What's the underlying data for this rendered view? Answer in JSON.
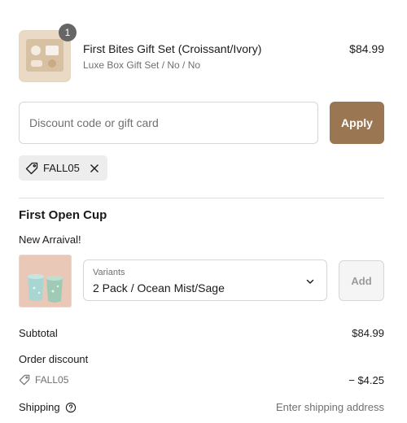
{
  "line_item": {
    "quantity": "1",
    "title": "First Bites Gift Set (Croissant/Ivory)",
    "variant": "Luxe Box Gift Set / No / No",
    "price": "$84.99"
  },
  "discount": {
    "placeholder": "Discount code or gift card",
    "value": "",
    "apply_label": "Apply",
    "applied_code": "FALL05"
  },
  "upsell": {
    "title": "First Open Cup",
    "subtitle": "New Arraival!",
    "variant_label": "Variants",
    "variant_value": "2 Pack / Ocean Mist/Sage",
    "add_label": "Add"
  },
  "summary": {
    "subtotal_label": "Subtotal",
    "subtotal_value": "$84.99",
    "order_discount_label": "Order discount",
    "discount_code": "FALL05",
    "discount_value": "− $4.25",
    "shipping_label": "Shipping",
    "shipping_value": "Enter shipping address"
  },
  "colors": {
    "accent": "#9b7652",
    "badge": "#666666",
    "muted_text": "#707070"
  }
}
